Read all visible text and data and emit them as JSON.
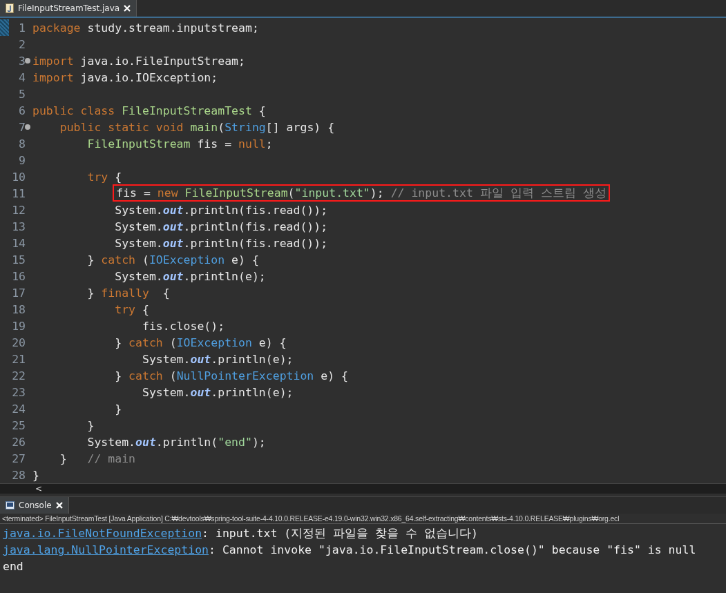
{
  "editor_tab": {
    "title": "FileInputStreamTest.java",
    "selected": true
  },
  "code_lines": [
    {
      "number": "1",
      "tokens": [
        {
          "kind": "kw",
          "t": "package"
        },
        {
          "kind": "plain",
          "t": " study.stream.inputstream;"
        }
      ]
    },
    {
      "number": "2"
    },
    {
      "number": "3",
      "fold": true,
      "tokens": [
        {
          "kind": "kw",
          "t": "import"
        },
        {
          "kind": "plain",
          "t": " java.io.FileInputStream;"
        }
      ]
    },
    {
      "number": "4",
      "tokens": [
        {
          "kind": "kw",
          "t": "import"
        },
        {
          "kind": "plain",
          "t": " java.io.IOException;"
        }
      ]
    },
    {
      "number": "5"
    },
    {
      "number": "6",
      "tokens": [
        {
          "kind": "kw",
          "t": "public class "
        },
        {
          "kind": "cls",
          "t": "FileInputStreamTest"
        },
        {
          "kind": "plain",
          "t": " {"
        }
      ]
    },
    {
      "number": "7",
      "fold": true,
      "tokens": [
        {
          "kind": "kw",
          "t": "    public static void "
        },
        {
          "kind": "method",
          "t": "main"
        },
        {
          "kind": "plain",
          "t": "("
        },
        {
          "kind": "lib",
          "t": "String"
        },
        {
          "kind": "plain",
          "t": "[] args) {"
        }
      ]
    },
    {
      "number": "8",
      "tokens": [
        {
          "kind": "type",
          "t": "        FileInputStream"
        },
        {
          "kind": "plain",
          "t": " fis = "
        },
        {
          "kind": "kw",
          "t": "null"
        },
        {
          "kind": "plain",
          "t": ";"
        }
      ]
    },
    {
      "number": "9"
    },
    {
      "number": "10",
      "tokens": [
        {
          "kind": "kw",
          "t": "        try"
        },
        {
          "kind": "plain",
          "t": " {"
        }
      ]
    },
    {
      "number": "11",
      "highlighted": true,
      "tokens": [
        {
          "kind": "plain",
          "t": "            fis = "
        },
        {
          "kind": "kw",
          "t": "new "
        },
        {
          "kind": "type",
          "t": "FileInputStream"
        },
        {
          "kind": "plain",
          "t": "("
        },
        {
          "kind": "str",
          "t": "\"input.txt\""
        },
        {
          "kind": "plain",
          "t": "); "
        },
        {
          "kind": "comment",
          "t": "// input.txt 파일 입력 스트림 생성"
        }
      ]
    },
    {
      "number": "12",
      "tokens": [
        {
          "kind": "plain",
          "t": "            System."
        },
        {
          "kind": "field",
          "t": "out"
        },
        {
          "kind": "plain",
          "t": ".println(fis.read());"
        }
      ]
    },
    {
      "number": "13",
      "tokens": [
        {
          "kind": "plain",
          "t": "            System."
        },
        {
          "kind": "field",
          "t": "out"
        },
        {
          "kind": "plain",
          "t": ".println(fis.read());"
        }
      ]
    },
    {
      "number": "14",
      "tokens": [
        {
          "kind": "plain",
          "t": "            System."
        },
        {
          "kind": "field",
          "t": "out"
        },
        {
          "kind": "plain",
          "t": ".println(fis.read());"
        }
      ]
    },
    {
      "number": "15",
      "tokens": [
        {
          "kind": "plain",
          "t": "        } "
        },
        {
          "kind": "kw",
          "t": "catch"
        },
        {
          "kind": "plain",
          "t": " ("
        },
        {
          "kind": "lib",
          "t": "IOException"
        },
        {
          "kind": "plain",
          "t": " e) {"
        }
      ]
    },
    {
      "number": "16",
      "tokens": [
        {
          "kind": "plain",
          "t": "            System."
        },
        {
          "kind": "field",
          "t": "out"
        },
        {
          "kind": "plain",
          "t": ".println(e);"
        }
      ]
    },
    {
      "number": "17",
      "tokens": [
        {
          "kind": "plain",
          "t": "        } "
        },
        {
          "kind": "kw",
          "t": "finally"
        },
        {
          "kind": "plain",
          "t": "  {"
        }
      ]
    },
    {
      "number": "18",
      "tokens": [
        {
          "kind": "kw",
          "t": "            try"
        },
        {
          "kind": "plain",
          "t": " {"
        }
      ]
    },
    {
      "number": "19",
      "tokens": [
        {
          "kind": "plain",
          "t": "                fis.close();"
        }
      ]
    },
    {
      "number": "20",
      "tokens": [
        {
          "kind": "plain",
          "t": "            } "
        },
        {
          "kind": "kw",
          "t": "catch"
        },
        {
          "kind": "plain",
          "t": " ("
        },
        {
          "kind": "lib",
          "t": "IOException"
        },
        {
          "kind": "plain",
          "t": " e) {"
        }
      ]
    },
    {
      "number": "21",
      "tokens": [
        {
          "kind": "plain",
          "t": "                System."
        },
        {
          "kind": "field",
          "t": "out"
        },
        {
          "kind": "plain",
          "t": ".println(e);"
        }
      ]
    },
    {
      "number": "22",
      "tokens": [
        {
          "kind": "plain",
          "t": "            } "
        },
        {
          "kind": "kw",
          "t": "catch"
        },
        {
          "kind": "plain",
          "t": " ("
        },
        {
          "kind": "lib",
          "t": "NullPointerException"
        },
        {
          "kind": "plain",
          "t": " e) {"
        }
      ]
    },
    {
      "number": "23",
      "tokens": [
        {
          "kind": "plain",
          "t": "                System."
        },
        {
          "kind": "field",
          "t": "out"
        },
        {
          "kind": "plain",
          "t": ".println(e);"
        }
      ]
    },
    {
      "number": "24",
      "tokens": [
        {
          "kind": "plain",
          "t": "            }"
        }
      ]
    },
    {
      "number": "25",
      "tokens": [
        {
          "kind": "plain",
          "t": "        }"
        }
      ]
    },
    {
      "number": "26",
      "tokens": [
        {
          "kind": "plain",
          "t": "        System."
        },
        {
          "kind": "field",
          "t": "out"
        },
        {
          "kind": "plain",
          "t": ".println("
        },
        {
          "kind": "str",
          "t": "\"end\""
        },
        {
          "kind": "plain",
          "t": ");"
        }
      ]
    },
    {
      "number": "27",
      "tokens": [
        {
          "kind": "plain",
          "t": "    }   "
        },
        {
          "kind": "comment",
          "t": "// main"
        }
      ]
    },
    {
      "number": "28",
      "tokens": [
        {
          "kind": "plain",
          "t": "}"
        }
      ]
    }
  ],
  "hscroll": {
    "arrow": "<"
  },
  "console": {
    "tab": {
      "title": "Console",
      "selected": true
    },
    "info": "<terminated> FileInputStreamTest [Java Application] C:₩devtools₩spring-tool-suite-4-4.10.0.RELEASE-e4.19.0-win32.win32.x86_64.self-extracting₩contents₩sts-4.10.0.RELEASE₩plugins₩org.ecl",
    "output": [
      {
        "link": "java.io.FileNotFoundException",
        "text": ": input.txt (지정된 파일을 찾을 수 없습니다)"
      },
      {
        "link": "java.lang.NullPointerException",
        "text": ": Cannot invoke \"java.io.FileInputStream.close()\" because \"fis\" is null"
      },
      {
        "text": "end"
      }
    ]
  }
}
